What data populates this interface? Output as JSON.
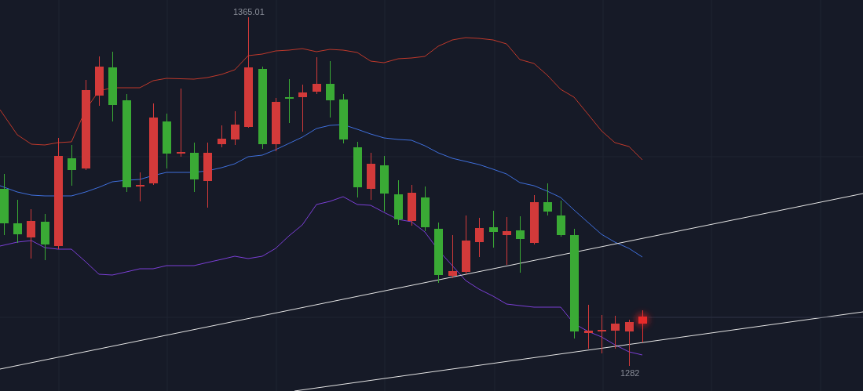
{
  "chart": {
    "high_label": "1365.01",
    "low_label": "1282"
  }
}
